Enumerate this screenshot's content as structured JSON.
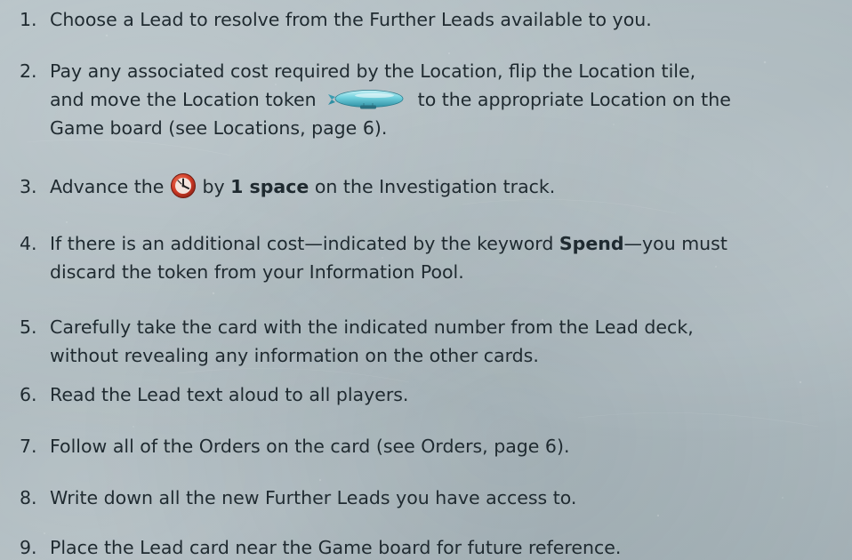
{
  "steps": [
    {
      "num": "1.",
      "text": "Choose a Lead to resolve from the Further Leads available to you."
    },
    {
      "num": "2.",
      "line1_a": "Pay any associated cost required by the Location, flip the Location tile,",
      "line2_a": "and move the Location token",
      "line2_b": "to the appropriate Location on the",
      "line3": "Game board (see Locations, page 6)."
    },
    {
      "num": "3.",
      "a": "Advance the",
      "b": "by",
      "bold": "1 space",
      "c": "on the Investigation track."
    },
    {
      "num": "4.",
      "line1_a": "If there is an additional cost—indicated by the keyword",
      "bold": "Spend",
      "line1_b": "—you must",
      "line2": "discard the token from your Information Pool."
    },
    {
      "num": "5.",
      "line1": "Carefully take the card with the indicated number from the Lead deck,",
      "line2": "without revealing any information on the other cards."
    },
    {
      "num": "6.",
      "text": "Read the Lead text aloud to all players."
    },
    {
      "num": "7.",
      "text": "Follow all of the Orders on the card (see Orders, page 6)."
    },
    {
      "num": "8.",
      "text": "Write down all the new Further Leads you have access to."
    },
    {
      "num": "9.",
      "text": "Place the Lead card near the Game board for future reference."
    }
  ],
  "icons": {
    "location_token": "airship-token-icon",
    "investigation_marker": "clock-marker-icon"
  },
  "colors": {
    "background": "#adb9be",
    "text": "#1f2a30",
    "token": "#5fc3d2",
    "marker": "#d2432e"
  }
}
